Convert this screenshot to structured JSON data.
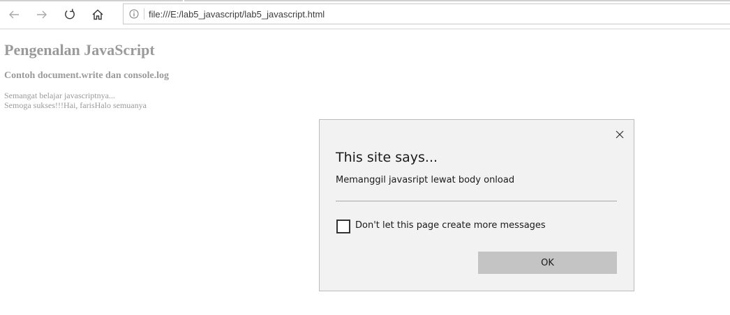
{
  "browser": {
    "url": "file:///E:/lab5_javascript/lab5_javascript.html",
    "icons": {
      "back": "back-arrow-icon",
      "forward": "forward-arrow-icon",
      "refresh": "refresh-icon",
      "home": "home-icon",
      "site_info": "info-icon"
    }
  },
  "page": {
    "title": "Pengenalan JavaScript",
    "subtitle": "Contoh document.write dan console.log",
    "lines": [
      "Semangat belajar javascriptnya...",
      "Semoga sukses!!!Hai, farisHalo semuanya"
    ]
  },
  "dialog": {
    "title": "This site says...",
    "message": "Memanggil javasript lewat body onload",
    "checkbox_label": "Don't let this page create more messages",
    "checkbox_checked": false,
    "ok_label": "OK"
  },
  "colors": {
    "page_text": "#9a9a9a",
    "dialog_background": "#f2f2f2",
    "ok_button": "#c4c4c4"
  }
}
